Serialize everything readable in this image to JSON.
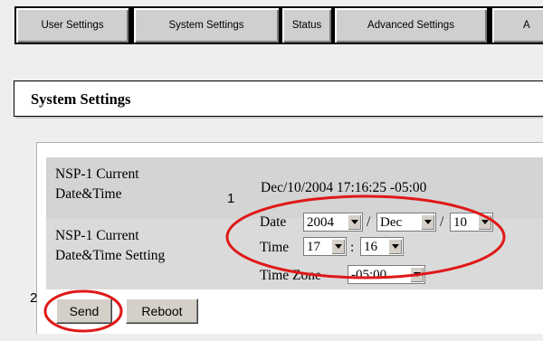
{
  "tabs": [
    "User Settings",
    "System Settings",
    "Status",
    "Advanced Settings",
    "A"
  ],
  "section_title": "System Settings",
  "current": {
    "label_line1": "NSP-1 Current",
    "label_line2": "Date&Time",
    "value": "Dec/10/2004 17:16:25 -05:00"
  },
  "setting": {
    "label_line1": "NSP-1 Current",
    "label_line2": "Date&Time Setting",
    "date_label": "Date",
    "year": "2004",
    "month": "Dec",
    "day": "10",
    "sep": "/",
    "time_label": "Time",
    "hour": "17",
    "minute": "16",
    "time_sep": ":",
    "tz_label": "Time Zone",
    "tz": "-05:00"
  },
  "buttons": {
    "send": "Send",
    "reboot": "Reboot"
  },
  "annotations": {
    "one": "1",
    "two": "2",
    "color": "#e01818"
  }
}
